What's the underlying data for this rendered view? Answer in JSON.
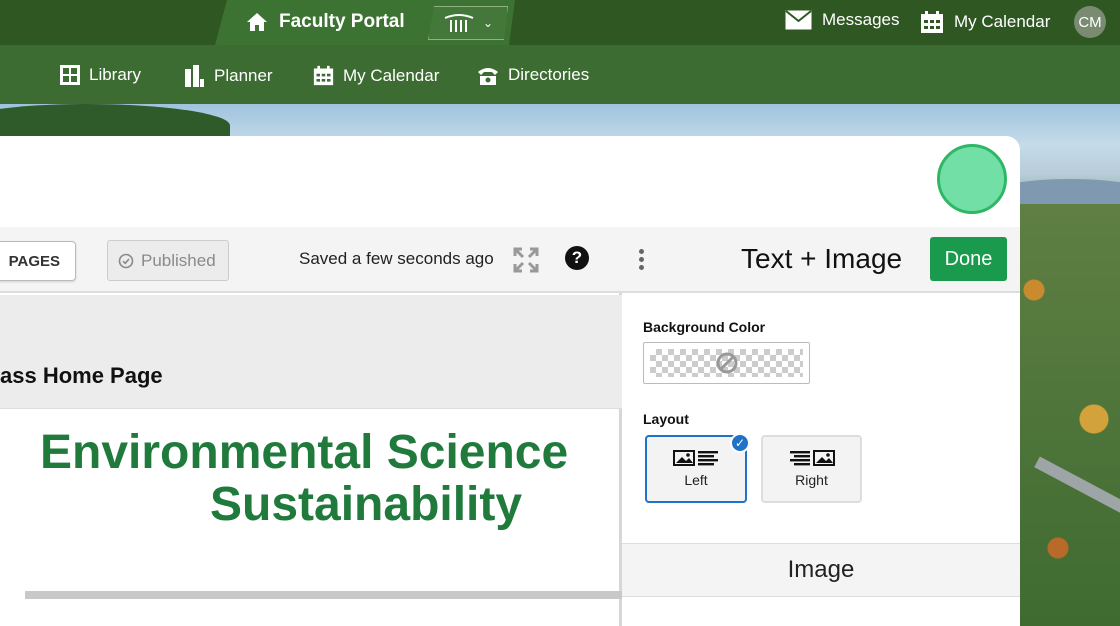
{
  "topbar": {
    "title": "Faculty Portal",
    "messages_label": "Messages",
    "calendar_label": "My Calendar",
    "avatar_initials": "CM",
    "colors": {
      "bar": "#2e5722",
      "tab": "#3d7332"
    }
  },
  "nav": {
    "items": [
      {
        "label": "Library",
        "icon": "grid-icon"
      },
      {
        "label": "Planner",
        "icon": "planner-icon"
      },
      {
        "label": "My Calendar",
        "icon": "calendar-icon"
      },
      {
        "label": "Directories",
        "icon": "phone-icon"
      }
    ]
  },
  "editor": {
    "pages_label": "PAGES",
    "published_label": "Published",
    "saved_status": "Saved a few seconds ago",
    "page_title": "ass Home Page",
    "heading_line1": "Environmental Science",
    "heading_line2": "Sustainability",
    "heading_color": "#1f7a3c"
  },
  "sidebar": {
    "title": "Text + Image",
    "done_label": "Done",
    "background_color_label": "Background Color",
    "layout_label": "Layout",
    "layout_options": [
      {
        "label": "Left",
        "selected": true
      },
      {
        "label": "Right",
        "selected": false
      }
    ],
    "image_section_label": "Image",
    "accent": "#1e73c8",
    "done_color": "#1a9a4c"
  }
}
